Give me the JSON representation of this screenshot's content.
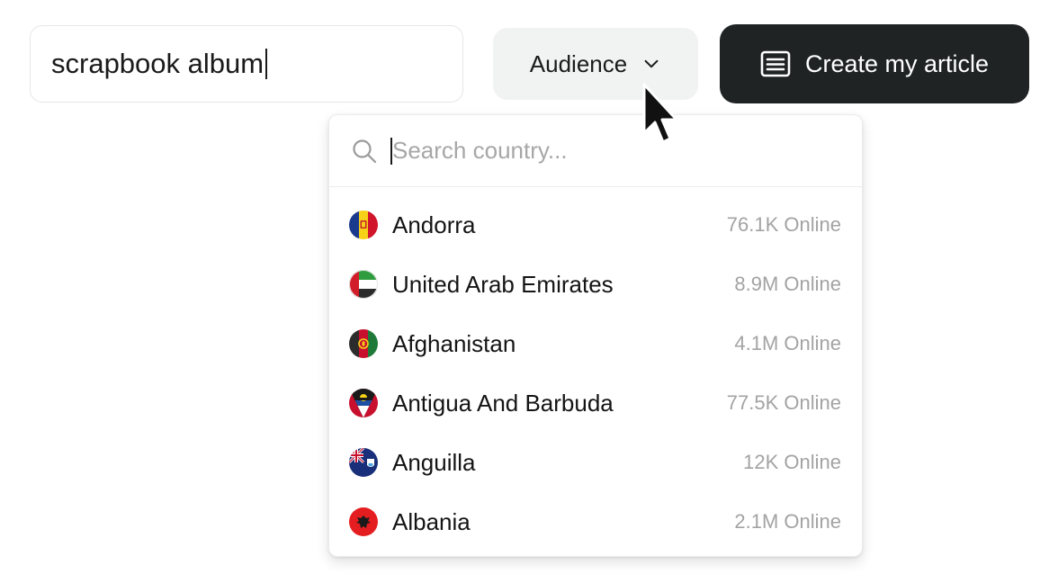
{
  "topic_input": {
    "value": "scrapbook album"
  },
  "audience_button": {
    "label": "Audience",
    "icon": "chevron-down-icon"
  },
  "create_button": {
    "label": "Create my article",
    "icon": "article-icon"
  },
  "country_dropdown": {
    "search_placeholder": "Search country...",
    "search_icon": "search-icon",
    "items": [
      {
        "name": "Andorra",
        "online": "76.1K Online",
        "flag": "andorra-flag-icon"
      },
      {
        "name": "United Arab Emirates",
        "online": "8.9M Online",
        "flag": "uae-flag-icon"
      },
      {
        "name": "Afghanistan",
        "online": "4.1M Online",
        "flag": "afghanistan-flag-icon"
      },
      {
        "name": "Antigua And Barbuda",
        "online": "77.5K Online",
        "flag": "antigua-flag-icon"
      },
      {
        "name": "Anguilla",
        "online": "12K Online",
        "flag": "anguilla-flag-icon"
      },
      {
        "name": "Albania",
        "online": "2.1M Online",
        "flag": "albania-flag-icon"
      }
    ]
  },
  "colors": {
    "primary_button": "#202324",
    "secondary_button": "#f1f2f2",
    "muted_text": "#a3a3a3"
  }
}
